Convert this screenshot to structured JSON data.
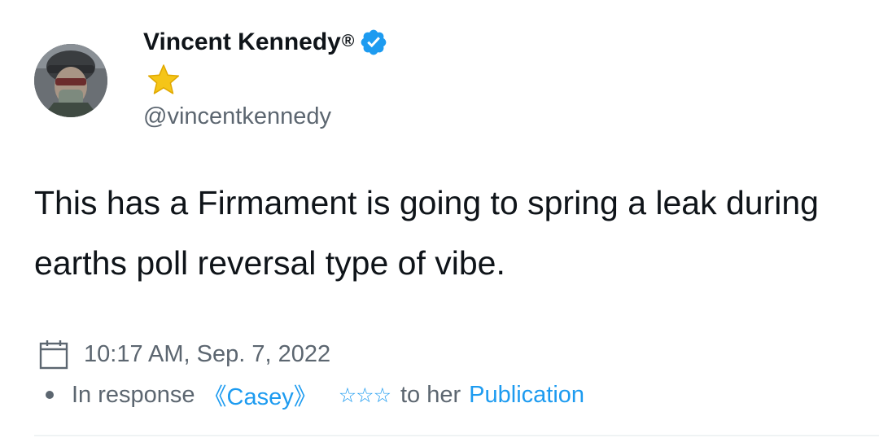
{
  "author": {
    "display_name": "Vincent Kennedy",
    "registered_mark": "®",
    "handle": "@vincentkennedy",
    "avatar_icon": "soldier-helmet-avatar",
    "verified_icon": "verified-badge-icon",
    "emoji_icon": "star-emoji-icon"
  },
  "tweet": {
    "text": "This has a Firmament is going to spring a leak during earths poll reversal type of vibe."
  },
  "meta": {
    "calendar_icon": "calendar-icon",
    "timestamp": "10:17 AM, Sep. 7, 2022"
  },
  "response": {
    "prefix": "In response",
    "name": "《Casey》",
    "stars": "☆☆☆",
    "middle": "to her",
    "link": "Publication"
  },
  "colors": {
    "accent": "#1d9bf0",
    "secondary_text": "#5c6670",
    "primary_text": "#0f1419",
    "star_gold": "#f5c518"
  }
}
